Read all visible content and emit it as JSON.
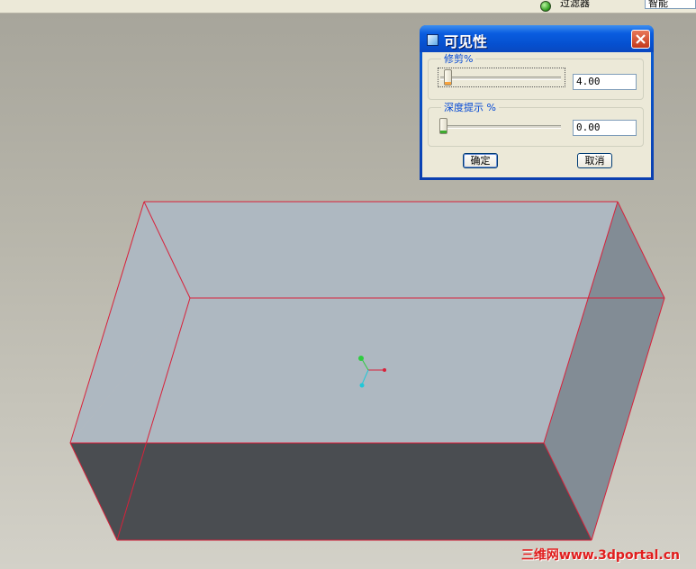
{
  "topbar": {
    "label": "过滤器",
    "filter_value": "智能"
  },
  "dialog": {
    "title": "可见性",
    "trim": {
      "label": "修剪%",
      "value": "4.00",
      "level_percent": 4
    },
    "depth_cue": {
      "label": "深度提示 %",
      "value": "0.00",
      "level_percent": 0
    },
    "ok_label": "确定",
    "cancel_label": "取消"
  },
  "colors": {
    "edge": "#d8213a",
    "top_face": "#aeb8c1",
    "front_face": "#4a4d51",
    "side_face": "#828c95"
  },
  "icons": [
    "status-led-icon",
    "dialog-window-icon",
    "close-icon",
    "coordinate-axes-icon"
  ],
  "watermark": "三维网www.3dportal.cn"
}
